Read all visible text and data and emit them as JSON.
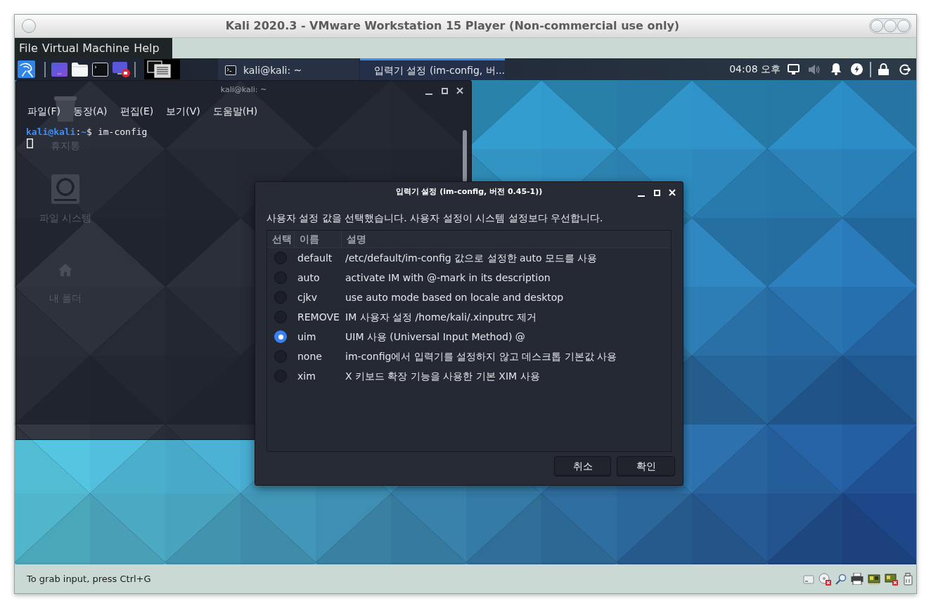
{
  "vm_window": {
    "title": "Kali 2020.3 - VMware Workstation 15 Player (Non-commercial use only)",
    "menu": [
      "File",
      "Virtual Machine",
      "Help"
    ]
  },
  "taskbar": {
    "tasks": [
      {
        "label": "kali@kali: ~",
        "kind": "terminal",
        "selected": false
      },
      {
        "label": "입력기 설정 (im-config, 버...",
        "kind": "list",
        "selected": true
      }
    ],
    "clock": "04:08 오후"
  },
  "desktop": {
    "icons": [
      {
        "label": "휴지통",
        "kind": "trash"
      },
      {
        "label": "파일 시스템",
        "kind": "drive"
      },
      {
        "label": "내 폴더",
        "kind": "home"
      }
    ]
  },
  "terminal": {
    "title": "kali@kali: ~",
    "menu": [
      "파일(F)",
      "동장(A)",
      "편집(E)",
      "보기(V)",
      "도움말(H)"
    ],
    "prompt": {
      "user": "kali@kali",
      "separator": ":",
      "path": "~",
      "symbol": "$"
    },
    "command": "im-config"
  },
  "dialog": {
    "title": "입력기 설정 (im-config, 버전 0.45-1))",
    "message": "사용자 설정 값을 선택했습니다. 사용자 설정이 시스템 설정보다 우선합니다.",
    "columns": [
      "선택",
      "이름",
      "설명"
    ],
    "rows": [
      {
        "name": "default",
        "description": "/etc/default/im-config 값으로 설정한 auto 모드를 사용",
        "selected": false
      },
      {
        "name": "auto",
        "description": "activate IM with @-mark in its description",
        "selected": false
      },
      {
        "name": "cjkv",
        "description": "use auto mode based on locale and desktop",
        "selected": false
      },
      {
        "name": "REMOVE",
        "description": "IM 사용자 설정 /home/kali/.xinputrc 제거",
        "selected": false
      },
      {
        "name": "uim",
        "description": "UIM 사용 (Universal Input Method) @",
        "selected": true
      },
      {
        "name": "none",
        "description": "im-config에서 입력기를 설정하지 않고 데스크톱 기본값 사용",
        "selected": false
      },
      {
        "name": "xim",
        "description": "X 키보드 확장 기능을 사용한 기본 XIM 사용",
        "selected": false
      }
    ],
    "buttons": [
      "취소",
      "확인"
    ]
  },
  "status_bar": {
    "text": "To grab input, press Ctrl+G"
  }
}
